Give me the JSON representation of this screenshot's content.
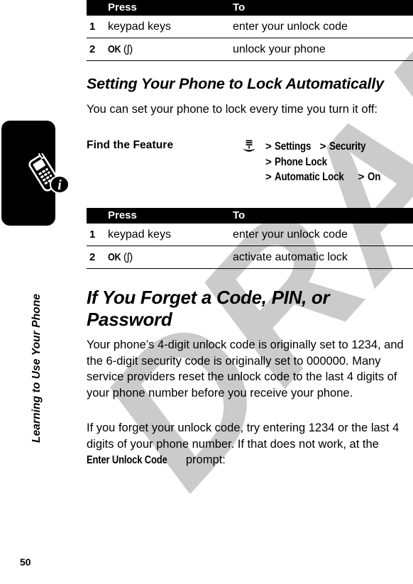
{
  "document": {
    "page_number": "50",
    "watermark": "DRAFT",
    "chapter_label": "Learning to Use Your Phone",
    "chapter_icon": "phone-info-icon"
  },
  "tables": [
    {
      "id": "unlock-phone-steps",
      "headers": {
        "num": "",
        "press": "Press",
        "to": "To"
      },
      "rows": [
        {
          "num": "1",
          "press_text": "keypad keys",
          "press_is_softkey": false,
          "to": "enter your unlock code"
        },
        {
          "num": "2",
          "press_text": "OK",
          "press_is_softkey": true,
          "softkey_glyph": "(ʃ)",
          "to": "unlock your phone"
        }
      ]
    },
    {
      "id": "automatic-lock-steps",
      "headers": {
        "num": "",
        "press": "Press",
        "to": "To"
      },
      "rows": [
        {
          "num": "1",
          "press_text": "keypad keys",
          "press_is_softkey": false,
          "to": "enter your unlock code"
        },
        {
          "num": "2",
          "press_text": "OK",
          "press_is_softkey": true,
          "softkey_glyph": "(ʃ)",
          "to": "activate automatic lock"
        }
      ]
    }
  ],
  "sections": {
    "lock_automatically": {
      "heading": "Setting Your Phone to Lock Automatically",
      "intro": "You can set your phone to lock every time you turn it off:"
    },
    "forget_code": {
      "heading": "If You Forget a Code, PIN, or Password",
      "paragraph_1": "Your phone’s 4-digit unlock code is originally set to 1234, and the 6-digit security code is originally set to 000000. Many service providers reset the unlock code to the last 4 digits of your phone number before you receive your phone.",
      "paragraph_2_part_1": "If you forget your unlock code, try entering 1234 or the last 4 digits of your phone number. If that does not work, at the ",
      "paragraph_2_bold": "Enter Unlock Code",
      "paragraph_2_part_2": " prompt:"
    }
  },
  "find_feature": {
    "label": "Find the Feature",
    "icon": "menu-icon",
    "path_lines": [
      {
        "items": [
          "Settings",
          "Security"
        ]
      },
      {
        "items": [
          "Phone Lock"
        ]
      },
      {
        "items": [
          "Automatic Lock",
          "On"
        ]
      }
    ],
    "separator": ">"
  },
  "colors": {
    "text": "#000000",
    "table_header_bg": "#000000",
    "table_header_text": "#ffffff",
    "watermark": "#c9c9c9",
    "page_bg": "#ffffff"
  }
}
